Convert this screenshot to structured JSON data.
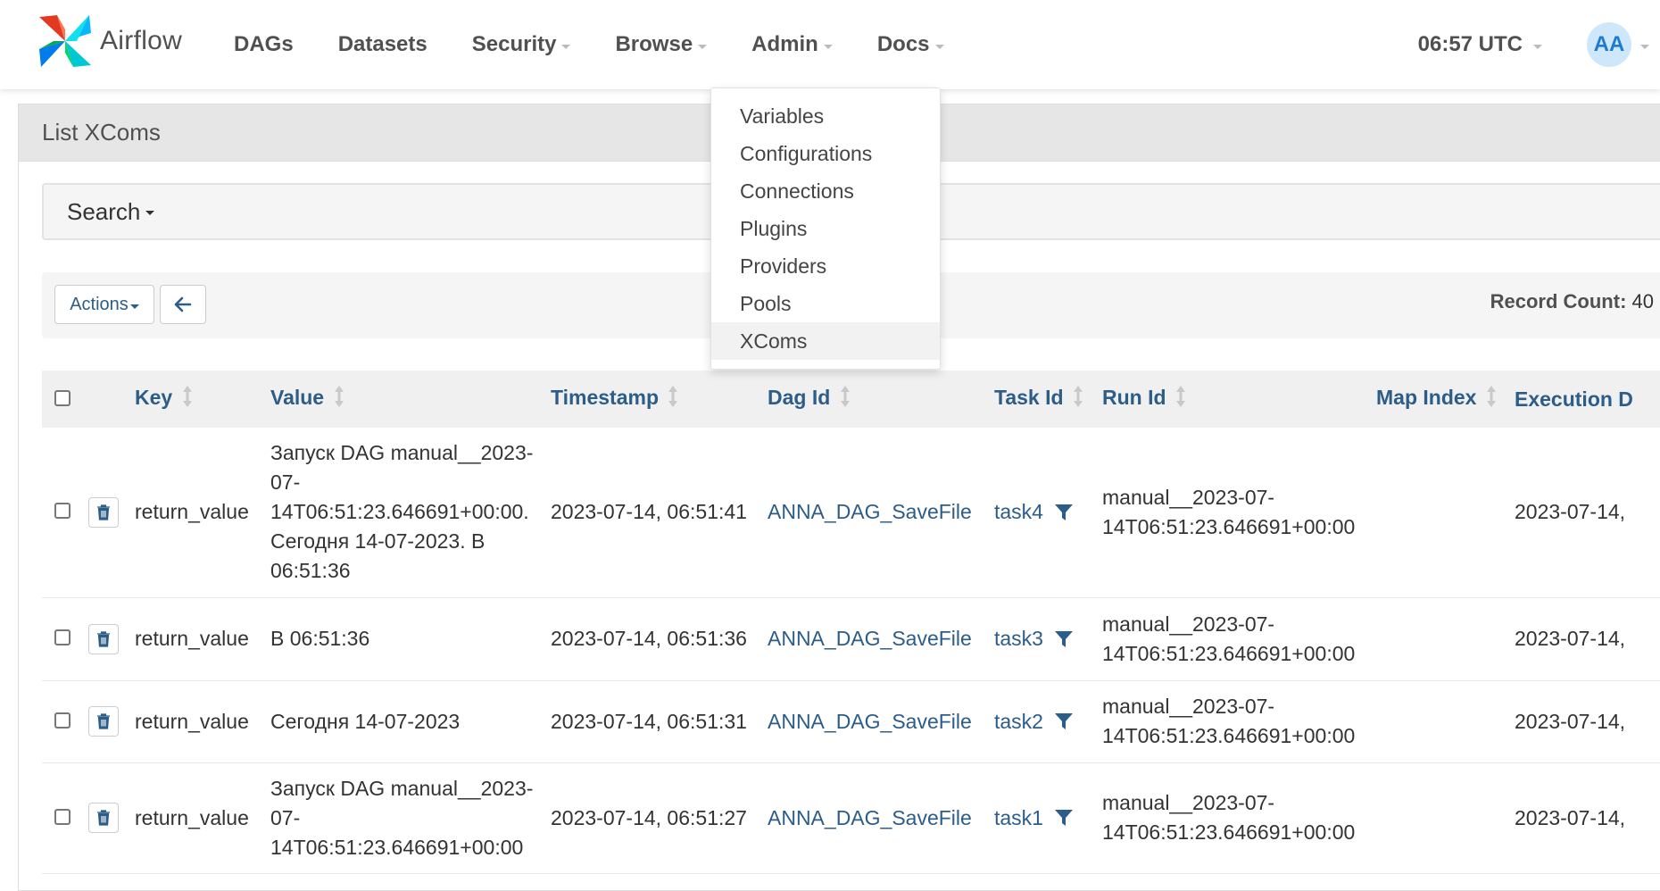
{
  "brand": {
    "name": "Airflow"
  },
  "nav": {
    "items": [
      {
        "label": "DAGs",
        "has_caret": false
      },
      {
        "label": "Datasets",
        "has_caret": false
      },
      {
        "label": "Security",
        "has_caret": true
      },
      {
        "label": "Browse",
        "has_caret": true
      },
      {
        "label": "Admin",
        "has_caret": true
      },
      {
        "label": "Docs",
        "has_caret": true
      }
    ],
    "clock": "06:57 UTC",
    "user_initials": "AA"
  },
  "admin_menu": {
    "items": [
      "Variables",
      "Configurations",
      "Connections",
      "Plugins",
      "Providers",
      "Pools",
      "XComs"
    ],
    "active": "XComs"
  },
  "panel": {
    "title": "List XComs",
    "search_label": "Search",
    "actions_label": "Actions",
    "record_count_label": "Record Count:",
    "record_count": "40"
  },
  "table": {
    "columns": [
      "Key",
      "Value",
      "Timestamp",
      "Dag Id",
      "Task Id",
      "Run Id",
      "Map Index",
      "Execution D"
    ],
    "rows": [
      {
        "key": "return_value",
        "value": "Запуск DAG manual__2023-07-14T06:51:23.646691+00:00. Сегодня 14-07-2023. В 06:51:36",
        "timestamp": "2023-07-14, 06:51:41",
        "dag_id": "ANNA_DAG_SaveFile",
        "task_id": "task4",
        "run_id": "manual__2023-07-14T06:51:23.646691+00:00",
        "map_index": "",
        "execution_date": "2023-07-14,"
      },
      {
        "key": "return_value",
        "value": "В 06:51:36",
        "timestamp": "2023-07-14, 06:51:36",
        "dag_id": "ANNA_DAG_SaveFile",
        "task_id": "task3",
        "run_id": "manual__2023-07-14T06:51:23.646691+00:00",
        "map_index": "",
        "execution_date": "2023-07-14,"
      },
      {
        "key": "return_value",
        "value": "Сегодня 14-07-2023",
        "timestamp": "2023-07-14, 06:51:31",
        "dag_id": "ANNA_DAG_SaveFile",
        "task_id": "task2",
        "run_id": "manual__2023-07-14T06:51:23.646691+00:00",
        "map_index": "",
        "execution_date": "2023-07-14,"
      },
      {
        "key": "return_value",
        "value": "Запуск DAG manual__2023-07-14T06:51:23.646691+00:00",
        "timestamp": "2023-07-14, 06:51:27",
        "dag_id": "ANNA_DAG_SaveFile",
        "task_id": "task1",
        "run_id": "manual__2023-07-14T06:51:23.646691+00:00",
        "map_index": "",
        "execution_date": "2023-07-14,"
      }
    ]
  },
  "colors": {
    "link": "#2c5d89",
    "nav_text": "#51504f",
    "header_bg": "#e6e6e6",
    "avatar_bg": "#cfe7fa",
    "avatar_text": "#1f7ad1"
  },
  "icons": [
    "airflow-logo-icon",
    "caret-down-icon",
    "arrow-left-icon",
    "sort-icon",
    "trash-icon",
    "filter-icon",
    "checkbox-icon"
  ]
}
